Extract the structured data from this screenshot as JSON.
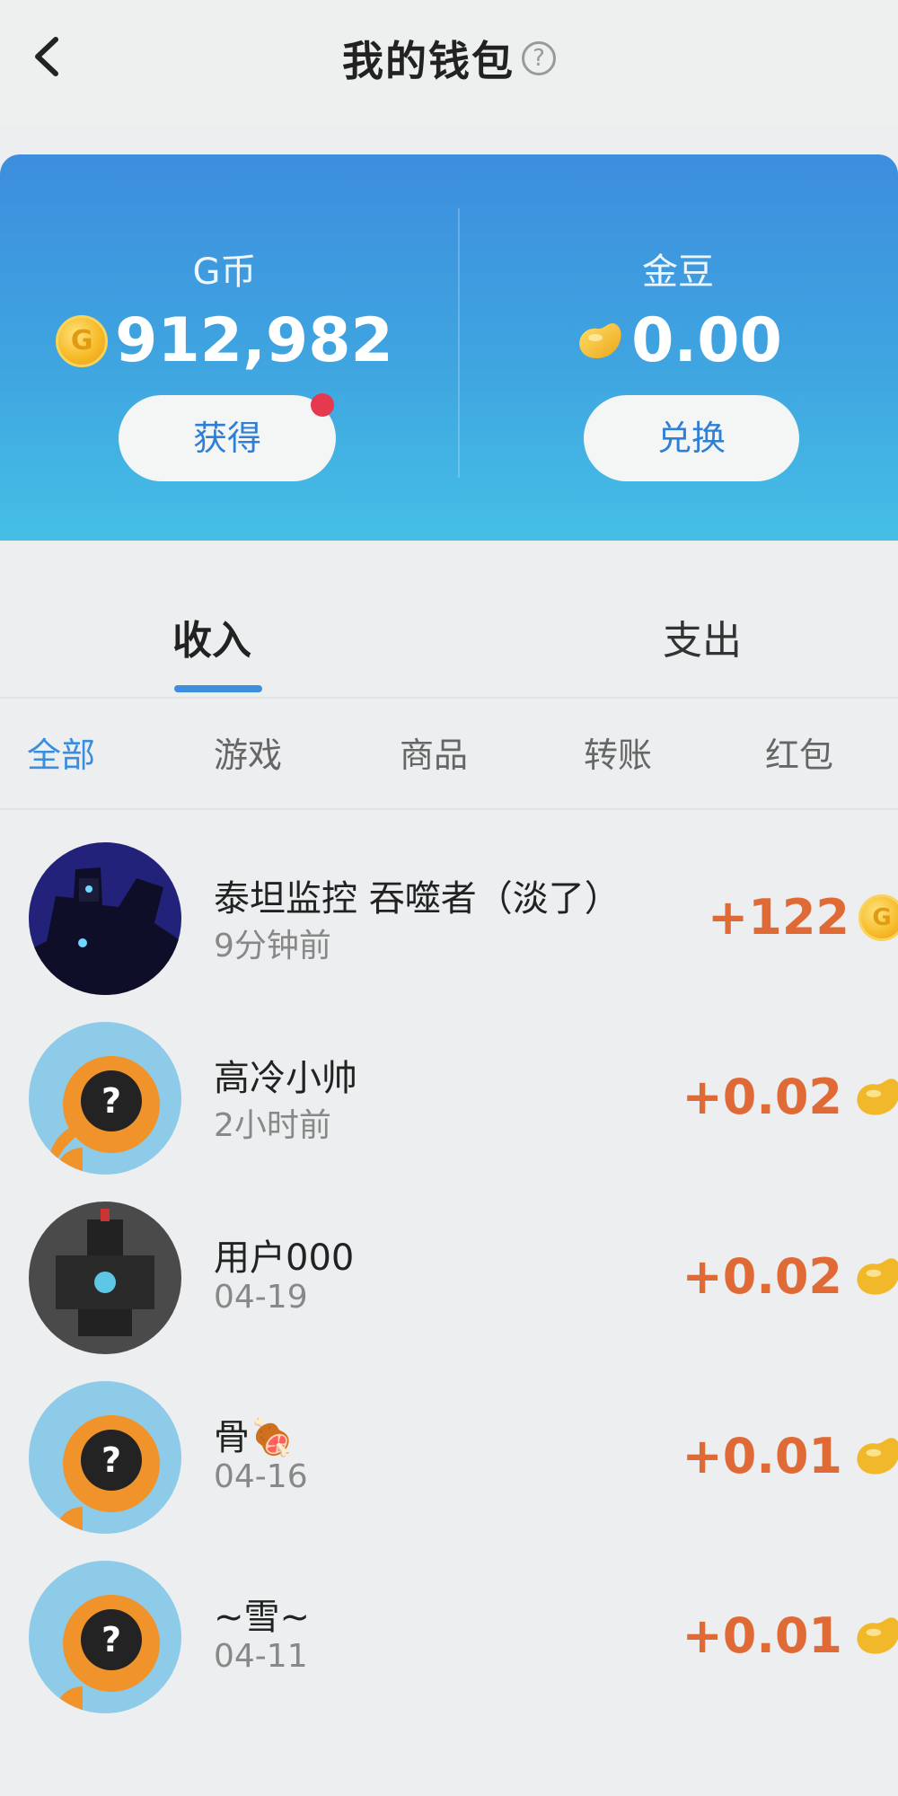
{
  "header": {
    "title": "我的钱包",
    "help_glyph": "?"
  },
  "wallet": {
    "gcoin": {
      "label": "G币",
      "amount": "912,982",
      "button_label": "获得",
      "has_notification": true
    },
    "golden_bean": {
      "label": "金豆",
      "amount": "0.00",
      "button_label": "兑换"
    }
  },
  "tabs": [
    {
      "label": "收入",
      "active": true
    },
    {
      "label": "支出",
      "active": false
    }
  ],
  "filters": [
    {
      "label": "全部",
      "active": true
    },
    {
      "label": "游戏",
      "active": false
    },
    {
      "label": "商品",
      "active": false
    },
    {
      "label": "转账",
      "active": false
    },
    {
      "label": "红包",
      "active": false
    }
  ],
  "transactions": [
    {
      "name": "泰坦监控  吞噬者（淡了）",
      "time": "9分钟前",
      "amount": "+122",
      "currency_icon": "gcoin-icon",
      "avatar": "titan-avatar"
    },
    {
      "name": "高冷小帅",
      "time": "2小时前",
      "amount": "+0.02",
      "currency_icon": "bean-icon",
      "avatar": "default-question-avatar"
    },
    {
      "name": "用户000",
      "time": "04-19",
      "amount": "+0.02",
      "currency_icon": "bean-icon",
      "avatar": "robot-avatar"
    },
    {
      "name": "骨🍖",
      "time": "04-16",
      "amount": "+0.01",
      "currency_icon": "bean-icon",
      "avatar": "default-question-avatar"
    },
    {
      "name": "~雪~",
      "time": "04-11",
      "amount": "+0.01",
      "currency_icon": "bean-icon",
      "avatar": "default-question-avatar"
    }
  ],
  "colors": {
    "accent": "#3d8ede",
    "income": "#e06a36",
    "notification": "#e53950"
  }
}
